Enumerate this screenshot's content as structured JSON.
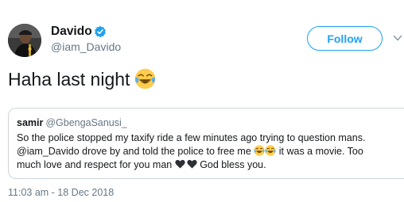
{
  "author": {
    "display_name": "Davido",
    "handle": "@iam_Davido",
    "verified": true
  },
  "follow_label": "Follow",
  "tweet": {
    "text": "Haha last night",
    "emoji": "face-with-tears-of-joy"
  },
  "quoted": {
    "name": "samir",
    "handle": "@GbengaSanusi_",
    "line1": "So the police stopped my taxify ride a few minutes ago trying to question mans.",
    "line2_before": "@iam_Davido drove by and told the police to free me",
    "line2_after": " it was a movie. Too",
    "line3_before": "much love and respect for you man",
    "line3_after": " God bless you."
  },
  "timestamp": "11:03 am - 18 Dec 2018",
  "colors": {
    "accent": "#1da1f2",
    "muted": "#657786",
    "border": "#ccd6dd"
  }
}
